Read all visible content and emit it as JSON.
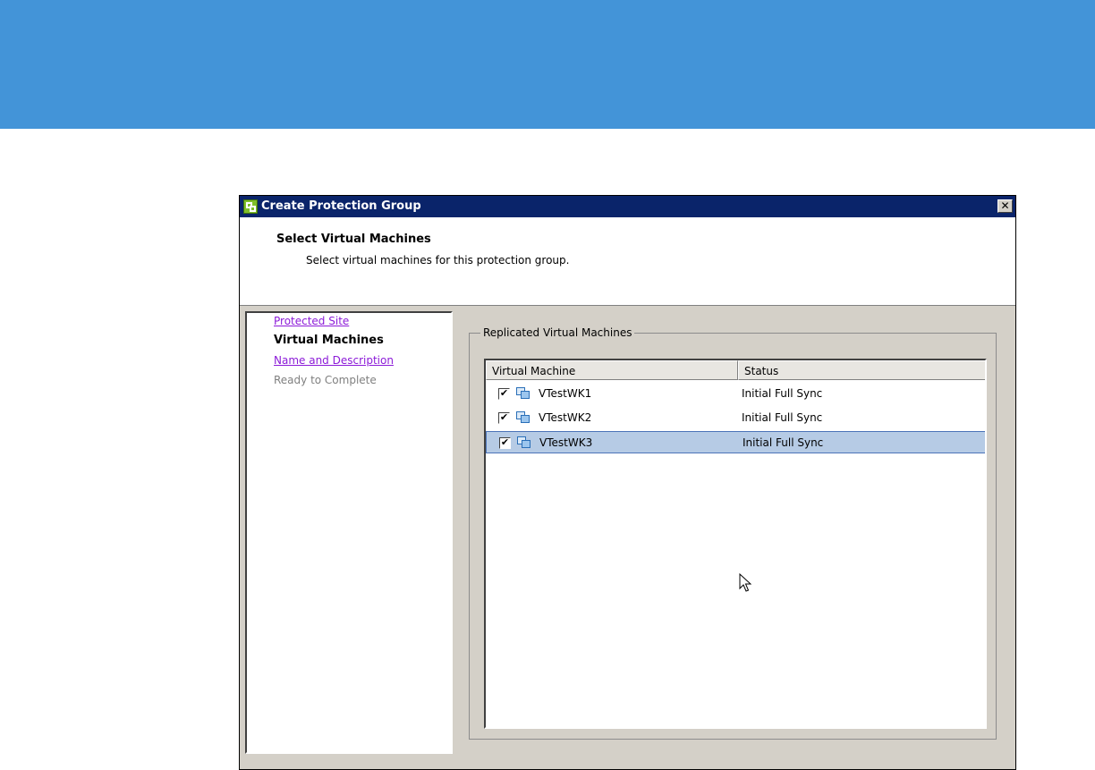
{
  "dialog": {
    "title": "Create Protection Group",
    "close_label": "✕"
  },
  "header": {
    "title": "Select Virtual Machines",
    "subtitle": "Select virtual machines for this protection group."
  },
  "nav": {
    "items": [
      {
        "label": "Protected Site",
        "state": "link"
      },
      {
        "label": "Virtual Machines",
        "state": "current"
      },
      {
        "label": "Name and Description",
        "state": "link"
      },
      {
        "label": "Ready to Complete",
        "state": "disabled"
      }
    ]
  },
  "group": {
    "legend": "Replicated Virtual Machines"
  },
  "table": {
    "columns": [
      "Virtual Machine",
      "Status"
    ],
    "rows": [
      {
        "name": "VTestWK1",
        "status": "Initial Full Sync",
        "checked": true,
        "selected": false
      },
      {
        "name": "VTestWK2",
        "status": "Initial Full Sync",
        "checked": true,
        "selected": false
      },
      {
        "name": "VTestWK3",
        "status": "Initial Full Sync",
        "checked": true,
        "selected": true
      }
    ]
  },
  "check_glyph": "✔",
  "colors": {
    "banner": "#4394d8",
    "titlebar": "#0a246a",
    "link": "#8c1bd8",
    "selection": "#b6cbe5"
  },
  "icons": {
    "title": "protection-group-icon",
    "row": "virtual-machine-icon",
    "close": "close-icon"
  }
}
